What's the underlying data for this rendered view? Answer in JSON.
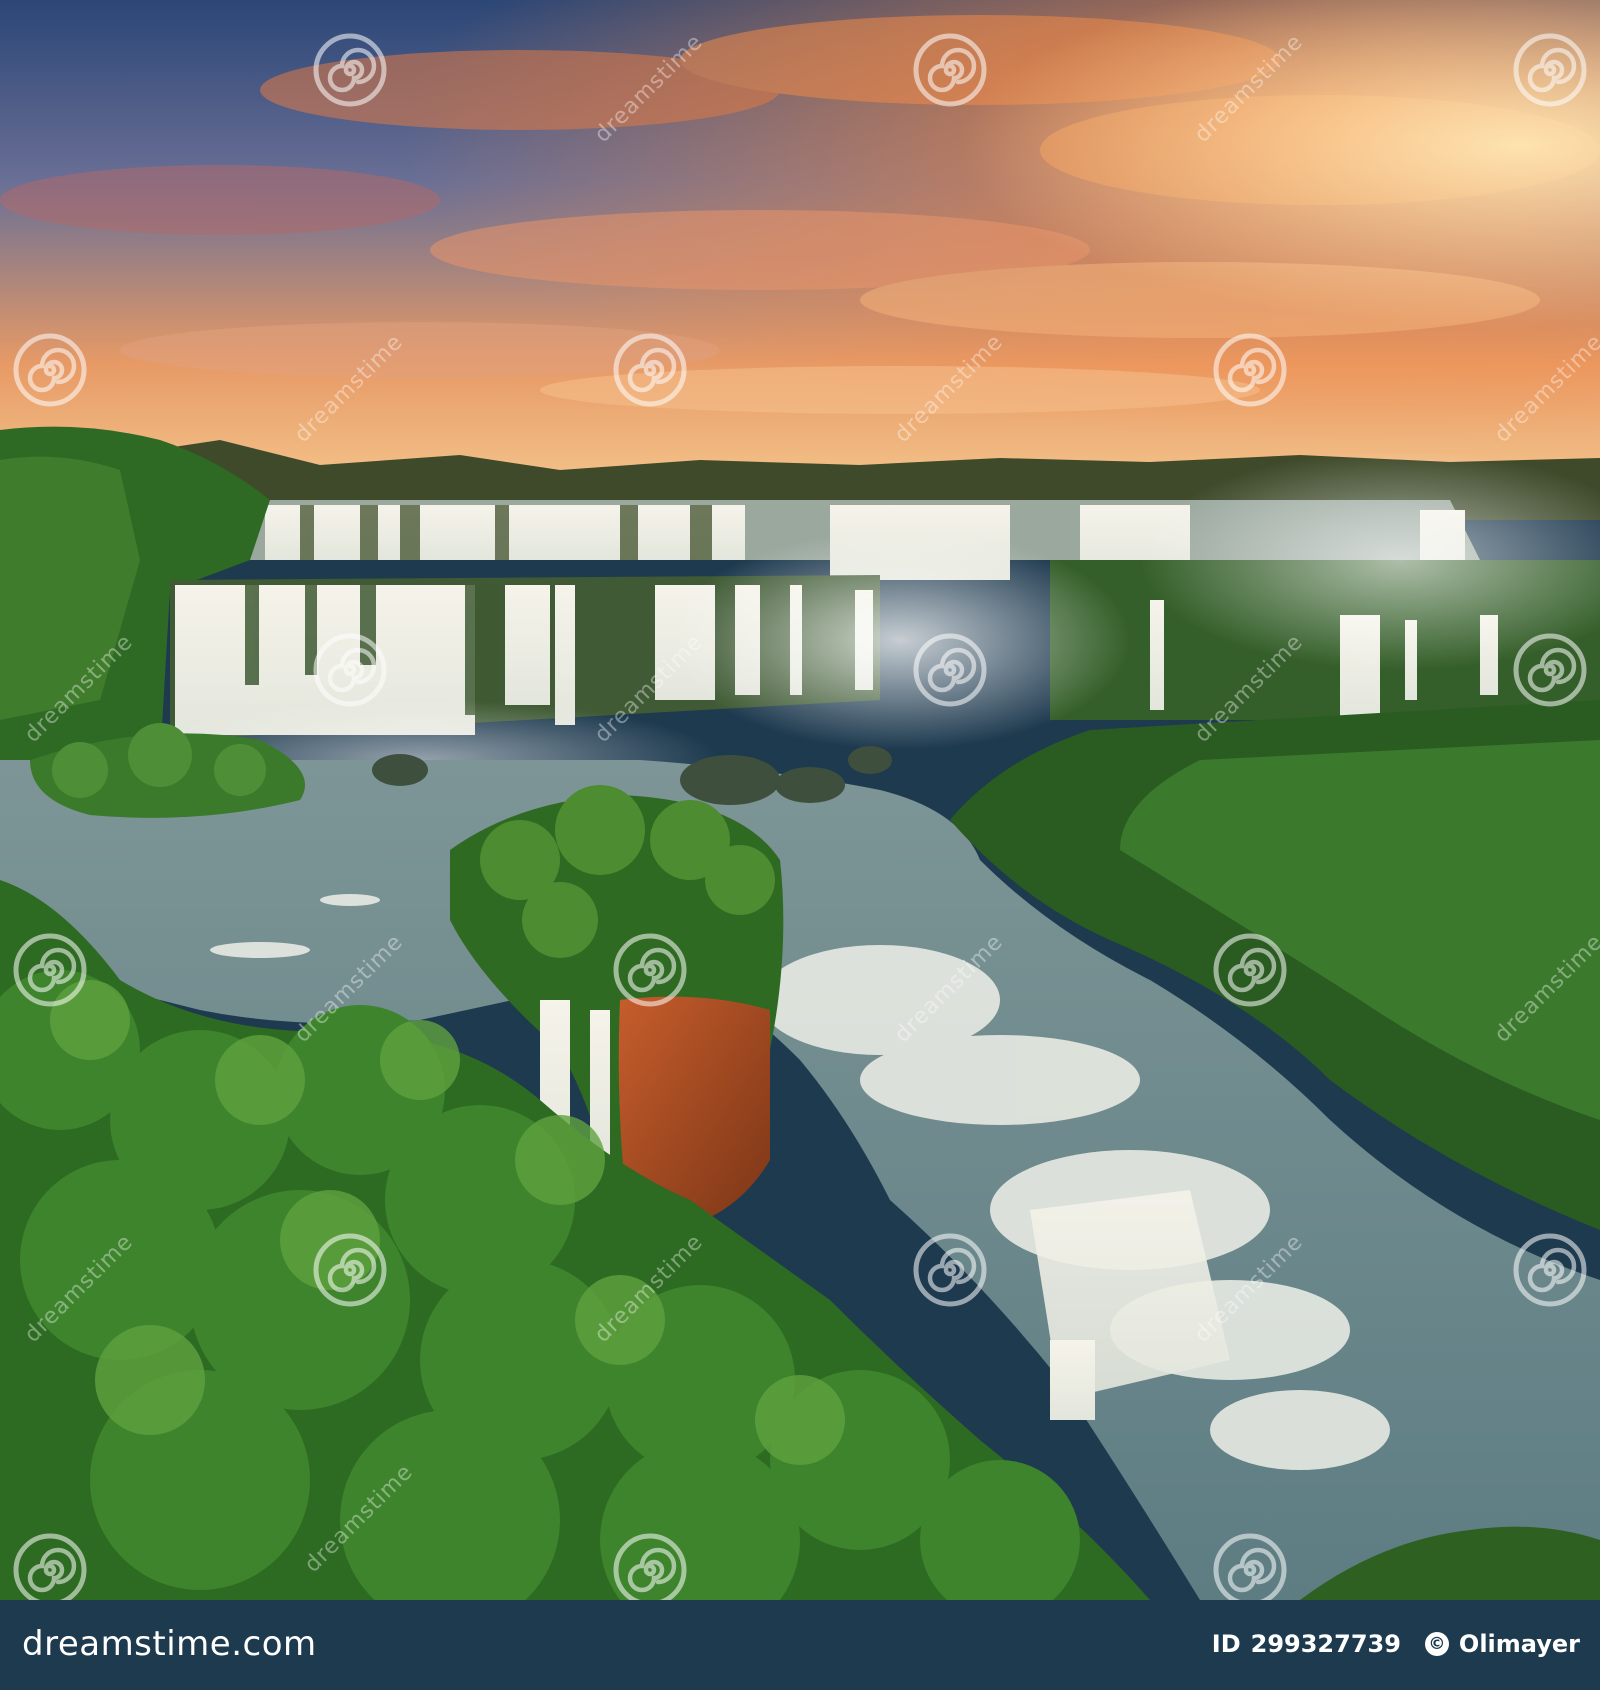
{
  "image": {
    "subject": "waterfalls",
    "colors": {
      "sky_top": "#2f4a7a",
      "sky_glow": "#f08a3e",
      "horizon": "#f6c27a",
      "forest": "#2f6a22",
      "forest_dark": "#1f4a18",
      "water": "#6f8e92",
      "falls": "#f2f0e6",
      "cliff": "#b0502a"
    }
  },
  "watermark": {
    "word": "dreamstime",
    "icon": "swirl-icon"
  },
  "footer": {
    "brand": "dreamstime.com",
    "id_label": "ID",
    "id_value": "299327739",
    "copyright_icon": "copyright-icon",
    "copyright_symbol": "©",
    "author": "Olimayer",
    "background": "#1e3a4f"
  }
}
